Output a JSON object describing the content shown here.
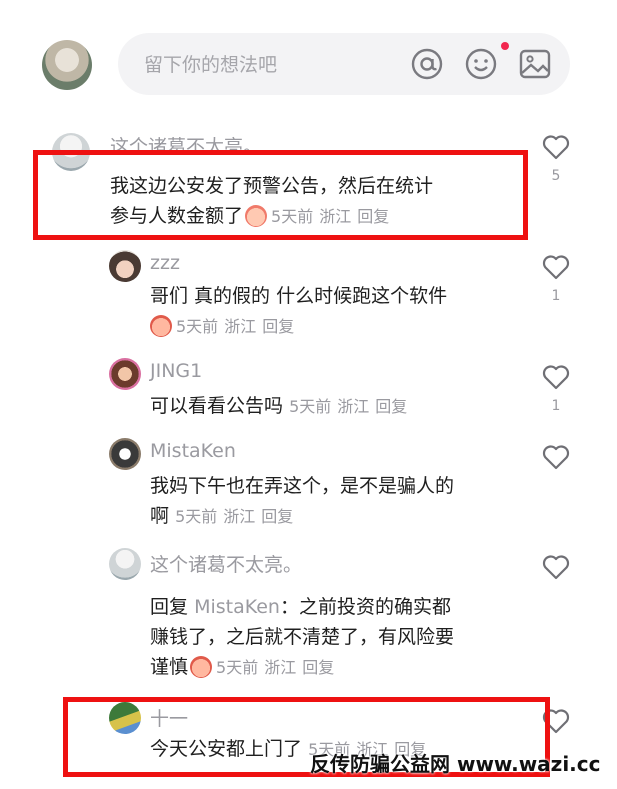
{
  "composer": {
    "placeholder": "留下你的想法吧",
    "icons": [
      "at-icon",
      "emoji-icon",
      "image-icon"
    ],
    "has_unread_dot": true
  },
  "comments": [
    {
      "name": "这个诸葛不太亮。",
      "text": "我这边公安发了预警公告，然后在统计参与人数金额了",
      "line1": "我这边公安发了预警公告，然后在统计",
      "line2": "参与人数金额了",
      "meta": {
        "time": "5天前",
        "location": "浙江",
        "reply": "回复"
      },
      "likes": "5"
    },
    {
      "name": "zzz",
      "text": "哥们 真的假的 什么时候跑这个软件",
      "meta": {
        "time": "5天前",
        "location": "浙江",
        "reply": "回复"
      },
      "likes": "1"
    },
    {
      "name": "JING1",
      "text": "可以看看公告吗",
      "meta": {
        "time": "5天前",
        "location": "浙江",
        "reply": "回复"
      },
      "likes": "1"
    },
    {
      "name": "MistaKen",
      "line1": "我妈下午也在弄这个，是不是骗人的",
      "line2": "啊",
      "meta": {
        "time": "5天前",
        "location": "浙江",
        "reply": "回复"
      },
      "likes": ""
    },
    {
      "name": "这个诸葛不太亮。",
      "reply_prefix": "回复",
      "reply_target": "MistaKen",
      "line1_rest": "：之前投资的确实都",
      "line2": "赚钱了，之后就不清楚了，有风险要",
      "line3": "谨慎",
      "meta": {
        "time": "5天前",
        "location": "浙江",
        "reply": "回复"
      },
      "likes": ""
    },
    {
      "name": "十一",
      "text": "今天公安都上门了",
      "meta": {
        "time": "5天前",
        "location": "浙江",
        "reply": "回复"
      },
      "likes": ""
    }
  ],
  "watermark": "反传防骗公益网 www.wazi.cc",
  "colors": {
    "highlight": "#ee1111",
    "secondary_text": "#9a9aa0",
    "red_dot": "#f2274f"
  }
}
